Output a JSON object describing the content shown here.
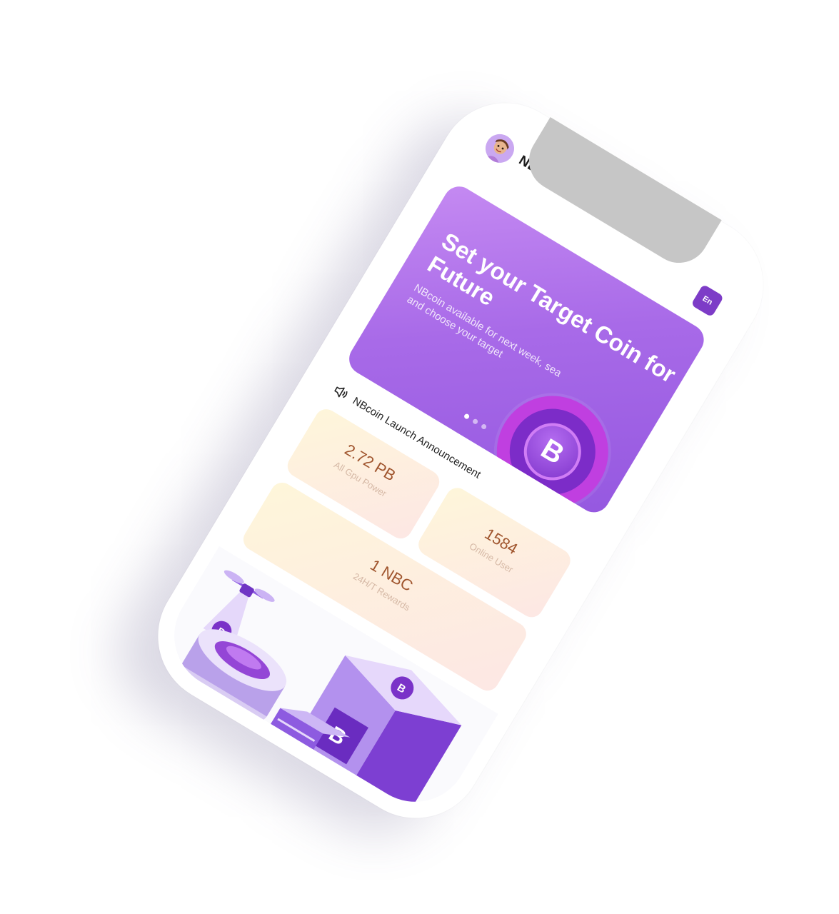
{
  "header": {
    "app_title": "NBCOIN",
    "avatar_icon": "avatar-icon",
    "lang_label": "En"
  },
  "banner": {
    "title": "Set your Target Coin for Future",
    "subtitle": "NBcoin available for next week, sea and choose your target",
    "coin_letter": "B",
    "slide_count": 3,
    "active_slide": 1
  },
  "announcement": {
    "text": "NBcoin Launch Announcement",
    "icon": "speaker-icon"
  },
  "stats": {
    "gpu_value": "2.72 PB",
    "gpu_label": "All Gpu Power",
    "users_value": "1584",
    "users_label": "Online User",
    "rewards_value": "1 NBC",
    "rewards_label": "24H/T Rewards"
  },
  "colors": {
    "accent": "#9b5de5",
    "stat_value": "#a0552e",
    "stat_label": "#d6b9a6"
  }
}
